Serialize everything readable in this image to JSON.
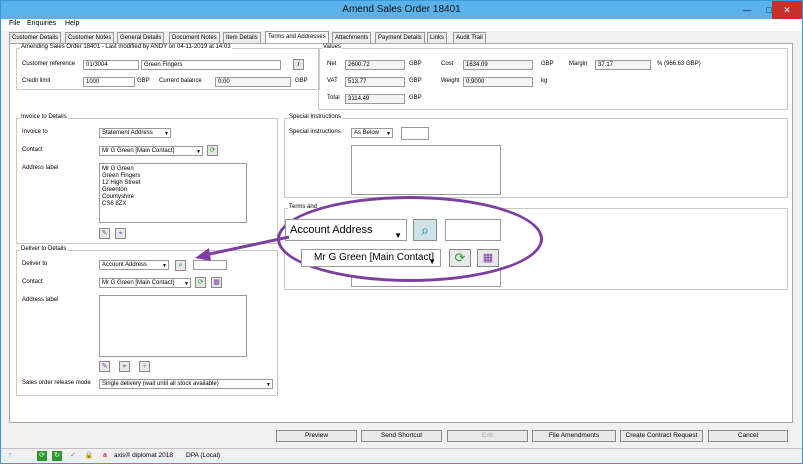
{
  "window": {
    "title": "Amend Sales Order 18401",
    "min": "—",
    "max": "□",
    "close": "✕"
  },
  "menu": [
    "File",
    "Enquiries",
    "Help"
  ],
  "tabs": [
    "Customer Details",
    "Customer Notes",
    "General Details",
    "Document Notes",
    "Item Details",
    "Terms and Addresses",
    "Attachments",
    "Payment Details",
    "Links",
    "Audit Trail"
  ],
  "header": {
    "info": "Amending Sales Order 18401 - Last modified by ANDY on 04-11-2019 at 14:03",
    "customer_reference_label": "Customer reference",
    "customer_reference": "01/3004",
    "customer_name": "Green Fingers",
    "credit_limit_label": "Credit limit",
    "credit_limit": "1000",
    "currency1": "GBP",
    "current_balance_label": "Current balance",
    "current_balance": "0.00",
    "currency2": "GBP"
  },
  "values": {
    "title": "Values",
    "net_label": "Net",
    "net": "2600.72",
    "net_cur": "GBP",
    "cost_label": "Cost",
    "cost": "1634.09",
    "cost_cur": "GBP",
    "margin_label": "Margin",
    "margin": "37.17",
    "margin_note": "% (966.63 GBP)",
    "vat_label": "VAT",
    "vat": "513.77",
    "vat_cur": "GBP",
    "weight_label": "Weight",
    "weight": "0.9000",
    "weight_unit": "kg",
    "total_label": "Total",
    "total": "3114.49",
    "total_cur": "GBP"
  },
  "invoice": {
    "title": "Invoice to Details",
    "invoice_to_label": "Invoice to",
    "invoice_to": "Statement Address",
    "contact_label": "Contact",
    "contact": "Mr G Green [Main Contact]",
    "address_label": "Address label",
    "address_lines": [
      "Mr G Green",
      "Green Fingers",
      "12 High Street",
      "Greenton",
      "Countyshire",
      "CS6 8ZX"
    ]
  },
  "deliver": {
    "title": "Deliver to Details",
    "deliver_to_label": "Deliver to",
    "deliver_to": "Account Address",
    "contact_label": "Contact",
    "contact": "Mr G Green [Main Contact]",
    "address_label": "Address label",
    "release_mode_label": "Sales order release mode",
    "release_mode": "Single delivery  (wait until all stock available)"
  },
  "special": {
    "title": "Special Instructions",
    "label": "Special instructions",
    "value": "As Below"
  },
  "terms": {
    "title": "Terms and"
  },
  "callout": {
    "deliver_to": "Account Address",
    "contact": "Mr G Green [Main Contact]"
  },
  "buttons": {
    "preview": "Preview",
    "send_shortcut": "Send Shortcut",
    "edit": "Edit",
    "file_amendments": "File Amendments",
    "create_contract": "Create Contract Request",
    "cancel": "Cancel"
  },
  "status": {
    "product": "axis® diplomat 2018",
    "dpa": "DPA (Local)"
  },
  "colors": {
    "accent": "#5bb1e9",
    "callout": "#7b3fa0"
  }
}
